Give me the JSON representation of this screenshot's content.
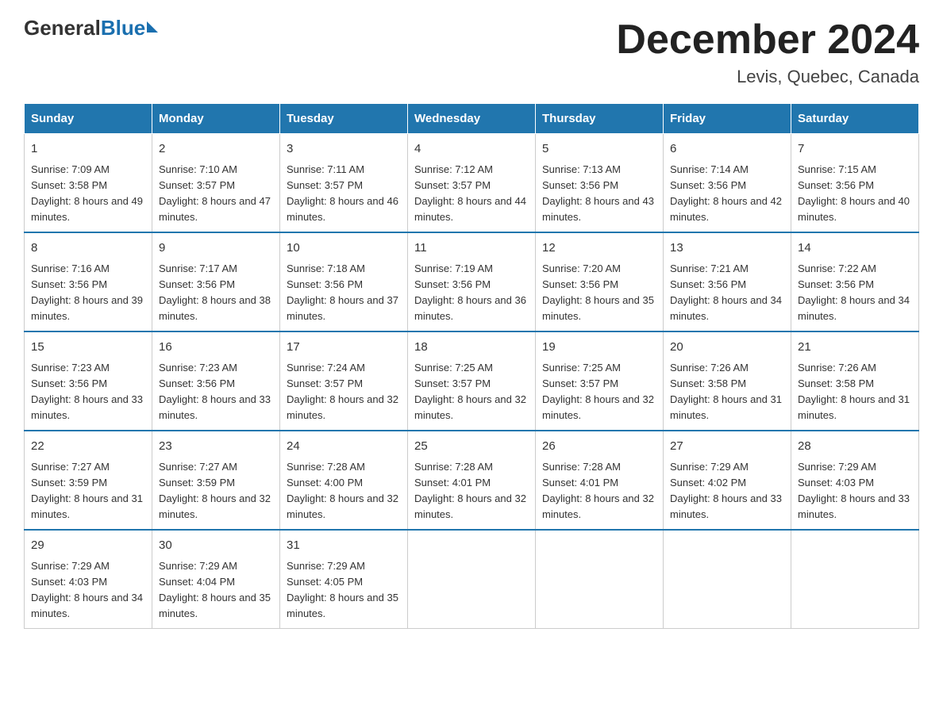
{
  "header": {
    "logo": {
      "general": "General",
      "blue": "Blue"
    },
    "title": "December 2024",
    "subtitle": "Levis, Quebec, Canada"
  },
  "columns": [
    "Sunday",
    "Monday",
    "Tuesday",
    "Wednesday",
    "Thursday",
    "Friday",
    "Saturday"
  ],
  "weeks": [
    [
      {
        "day": "1",
        "sunrise": "7:09 AM",
        "sunset": "3:58 PM",
        "daylight": "8 hours and 49 minutes."
      },
      {
        "day": "2",
        "sunrise": "7:10 AM",
        "sunset": "3:57 PM",
        "daylight": "8 hours and 47 minutes."
      },
      {
        "day": "3",
        "sunrise": "7:11 AM",
        "sunset": "3:57 PM",
        "daylight": "8 hours and 46 minutes."
      },
      {
        "day": "4",
        "sunrise": "7:12 AM",
        "sunset": "3:57 PM",
        "daylight": "8 hours and 44 minutes."
      },
      {
        "day": "5",
        "sunrise": "7:13 AM",
        "sunset": "3:56 PM",
        "daylight": "8 hours and 43 minutes."
      },
      {
        "day": "6",
        "sunrise": "7:14 AM",
        "sunset": "3:56 PM",
        "daylight": "8 hours and 42 minutes."
      },
      {
        "day": "7",
        "sunrise": "7:15 AM",
        "sunset": "3:56 PM",
        "daylight": "8 hours and 40 minutes."
      }
    ],
    [
      {
        "day": "8",
        "sunrise": "7:16 AM",
        "sunset": "3:56 PM",
        "daylight": "8 hours and 39 minutes."
      },
      {
        "day": "9",
        "sunrise": "7:17 AM",
        "sunset": "3:56 PM",
        "daylight": "8 hours and 38 minutes."
      },
      {
        "day": "10",
        "sunrise": "7:18 AM",
        "sunset": "3:56 PM",
        "daylight": "8 hours and 37 minutes."
      },
      {
        "day": "11",
        "sunrise": "7:19 AM",
        "sunset": "3:56 PM",
        "daylight": "8 hours and 36 minutes."
      },
      {
        "day": "12",
        "sunrise": "7:20 AM",
        "sunset": "3:56 PM",
        "daylight": "8 hours and 35 minutes."
      },
      {
        "day": "13",
        "sunrise": "7:21 AM",
        "sunset": "3:56 PM",
        "daylight": "8 hours and 34 minutes."
      },
      {
        "day": "14",
        "sunrise": "7:22 AM",
        "sunset": "3:56 PM",
        "daylight": "8 hours and 34 minutes."
      }
    ],
    [
      {
        "day": "15",
        "sunrise": "7:23 AM",
        "sunset": "3:56 PM",
        "daylight": "8 hours and 33 minutes."
      },
      {
        "day": "16",
        "sunrise": "7:23 AM",
        "sunset": "3:56 PM",
        "daylight": "8 hours and 33 minutes."
      },
      {
        "day": "17",
        "sunrise": "7:24 AM",
        "sunset": "3:57 PM",
        "daylight": "8 hours and 32 minutes."
      },
      {
        "day": "18",
        "sunrise": "7:25 AM",
        "sunset": "3:57 PM",
        "daylight": "8 hours and 32 minutes."
      },
      {
        "day": "19",
        "sunrise": "7:25 AM",
        "sunset": "3:57 PM",
        "daylight": "8 hours and 32 minutes."
      },
      {
        "day": "20",
        "sunrise": "7:26 AM",
        "sunset": "3:58 PM",
        "daylight": "8 hours and 31 minutes."
      },
      {
        "day": "21",
        "sunrise": "7:26 AM",
        "sunset": "3:58 PM",
        "daylight": "8 hours and 31 minutes."
      }
    ],
    [
      {
        "day": "22",
        "sunrise": "7:27 AM",
        "sunset": "3:59 PM",
        "daylight": "8 hours and 31 minutes."
      },
      {
        "day": "23",
        "sunrise": "7:27 AM",
        "sunset": "3:59 PM",
        "daylight": "8 hours and 32 minutes."
      },
      {
        "day": "24",
        "sunrise": "7:28 AM",
        "sunset": "4:00 PM",
        "daylight": "8 hours and 32 minutes."
      },
      {
        "day": "25",
        "sunrise": "7:28 AM",
        "sunset": "4:01 PM",
        "daylight": "8 hours and 32 minutes."
      },
      {
        "day": "26",
        "sunrise": "7:28 AM",
        "sunset": "4:01 PM",
        "daylight": "8 hours and 32 minutes."
      },
      {
        "day": "27",
        "sunrise": "7:29 AM",
        "sunset": "4:02 PM",
        "daylight": "8 hours and 33 minutes."
      },
      {
        "day": "28",
        "sunrise": "7:29 AM",
        "sunset": "4:03 PM",
        "daylight": "8 hours and 33 minutes."
      }
    ],
    [
      {
        "day": "29",
        "sunrise": "7:29 AM",
        "sunset": "4:03 PM",
        "daylight": "8 hours and 34 minutes."
      },
      {
        "day": "30",
        "sunrise": "7:29 AM",
        "sunset": "4:04 PM",
        "daylight": "8 hours and 35 minutes."
      },
      {
        "day": "31",
        "sunrise": "7:29 AM",
        "sunset": "4:05 PM",
        "daylight": "8 hours and 35 minutes."
      },
      null,
      null,
      null,
      null
    ]
  ]
}
